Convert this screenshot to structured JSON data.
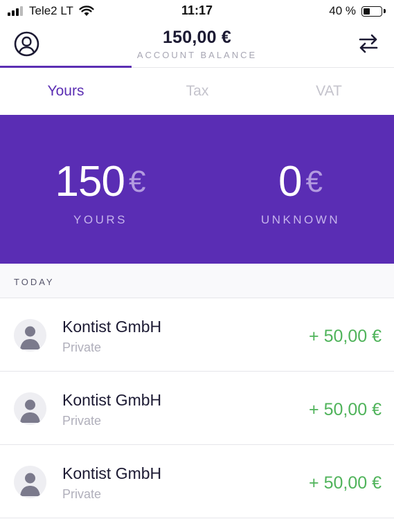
{
  "status_bar": {
    "carrier": "Tele2 LT",
    "time": "11:17",
    "battery": "40 %",
    "battery_level": 0.4
  },
  "header": {
    "balance": "150,00 €",
    "balance_label": "ACCOUNT BALANCE"
  },
  "tabs": [
    {
      "label": "Yours",
      "active": true
    },
    {
      "label": "Tax",
      "active": false
    },
    {
      "label": "VAT",
      "active": false
    }
  ],
  "summary": {
    "yours": {
      "value": "150",
      "currency": "€",
      "label": "YOURS"
    },
    "unknown": {
      "value": "0",
      "currency": "€",
      "label": "UNKNOWN"
    }
  },
  "section": {
    "title": "TODAY"
  },
  "transactions": [
    {
      "name": "Kontist GmbH",
      "category": "Private",
      "amount": "+ 50,00 €"
    },
    {
      "name": "Kontist GmbH",
      "category": "Private",
      "amount": "+ 50,00 €"
    },
    {
      "name": "Kontist GmbH",
      "category": "Private",
      "amount": "+ 50,00 €"
    }
  ],
  "colors": {
    "accent": "#5b2eb3",
    "panel": "#5a2db4",
    "positive": "#4fb35a"
  },
  "icons": {
    "profile": "user-circle-icon",
    "transfer": "transfer-arrows-icon",
    "avatar": "person-placeholder-icon"
  }
}
